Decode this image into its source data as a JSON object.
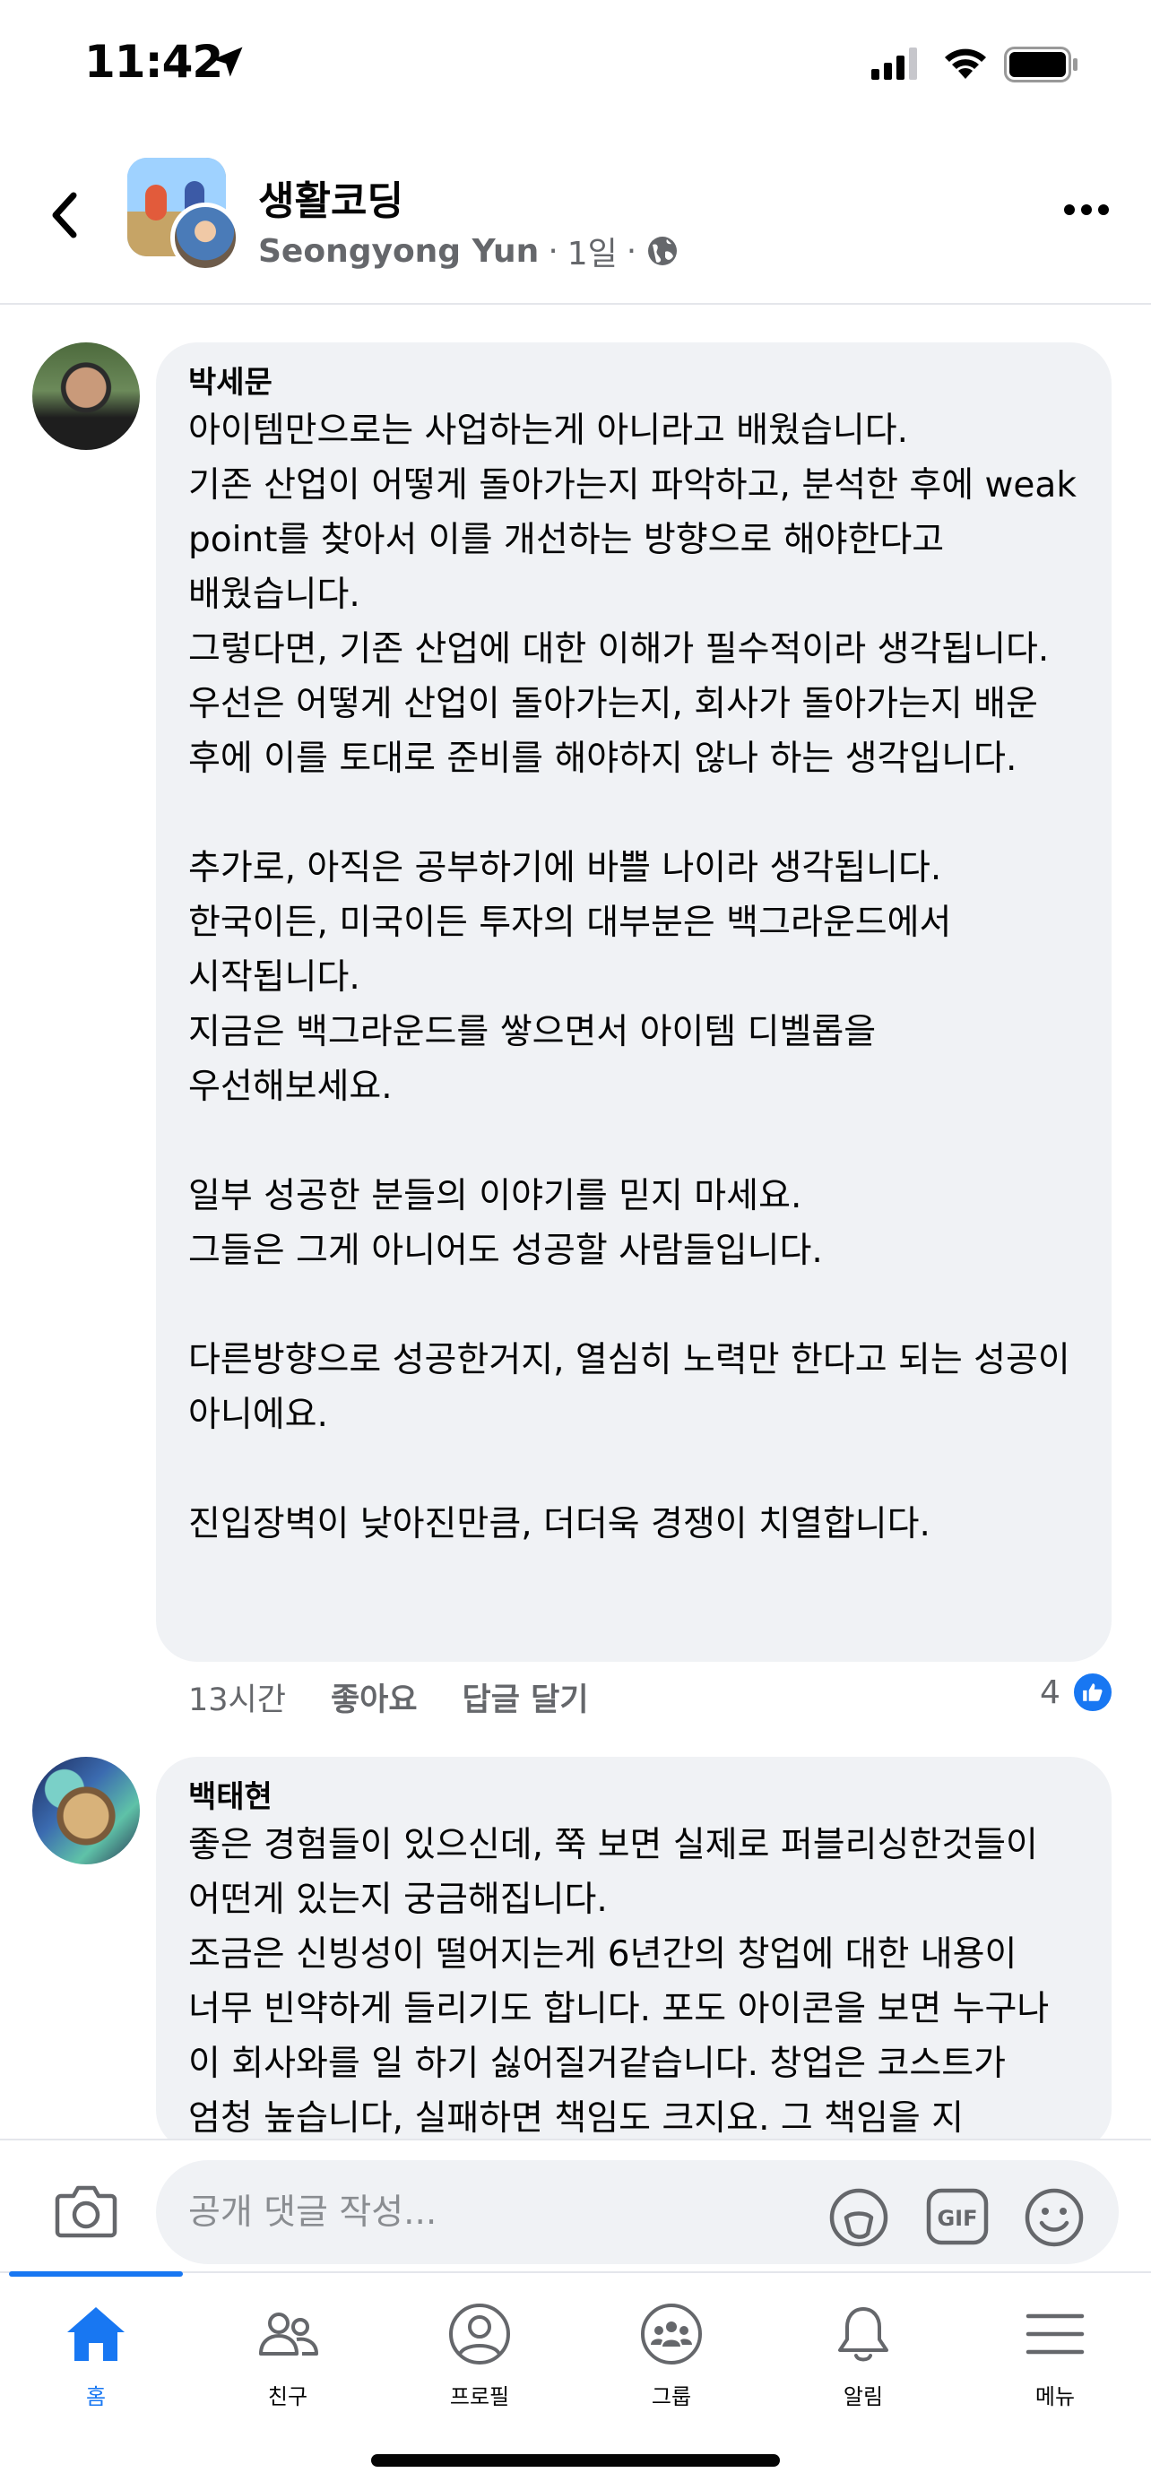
{
  "status_bar": {
    "time": "11:42"
  },
  "header": {
    "group_name": "생활코딩",
    "author": "Seongyong Yun",
    "time_ago": "1일",
    "separator": "·"
  },
  "comments": [
    {
      "author": "박세문",
      "text": "아이템만으로는 사업하는게 아니라고 배웠습니다.\n기존 산업이 어떻게 돌아가는지 파악하고, 분석한 후에 weak point를 찾아서 이를 개선하는 방향으로 해야한다고 배웠습니다.\n그렇다면, 기존 산업에 대한 이해가 필수적이라 생각됩니다.\n우선은 어떻게 산업이 돌아가는지, 회사가 돌아가는지 배운 후에 이를 토대로 준비를 해야하지 않나 하는 생각입니다.\n\n추가로, 아직은 공부하기에 바쁠 나이라 생각됩니다.\n한국이든, 미국이든 투자의 대부분은 백그라운드에서 시작됩니다.\n지금은 백그라운드를 쌓으면서 아이템 디벨롭을 우선해보세요.\n\n일부 성공한 분들의 이야기를 믿지 마세요.\n그들은 그게 아니어도 성공할 사람들입니다.\n\n다른방향으로 성공한거지, 열심히 노력만 한다고 되는 성공이 아니에요.\n\n진입장벽이 낮아진만큼, 더더욱 경쟁이 치열합니다.",
      "time": "13시간",
      "like_label": "좋아요",
      "reply_label": "답글 달기",
      "reaction_count": "4"
    },
    {
      "author": "백태현",
      "text": "좋은 경험들이 있으신데, 쭉 보면 실제로 퍼블리싱한것들이 어떤게 있는지 궁금해집니다.\n조금은 신빙성이 떨어지는게 6년간의 창업에 대한 내용이 너무 빈약하게 들리기도 합니다. 포도 아이콘을 보면 누구나 이 회사와를 일 하기 싫어질거같습니다. 창업은 코스트가 엄청 높습니다, 실패하면 책임도 크지요. 그 책임을 지"
    }
  ],
  "composer": {
    "placeholder": "공개 댓글 작성..."
  },
  "tabs": [
    {
      "label": "홈",
      "icon": "home-icon",
      "active": true
    },
    {
      "label": "친구",
      "icon": "friends-icon"
    },
    {
      "label": "프로필",
      "icon": "profile-icon"
    },
    {
      "label": "그룹",
      "icon": "groups-icon"
    },
    {
      "label": "알림",
      "icon": "bell-icon"
    },
    {
      "label": "메뉴",
      "icon": "menu-icon"
    }
  ],
  "colors": {
    "accent": "#1877f2",
    "bubble": "#f0f2f5",
    "secondary_text": "#65676b"
  }
}
